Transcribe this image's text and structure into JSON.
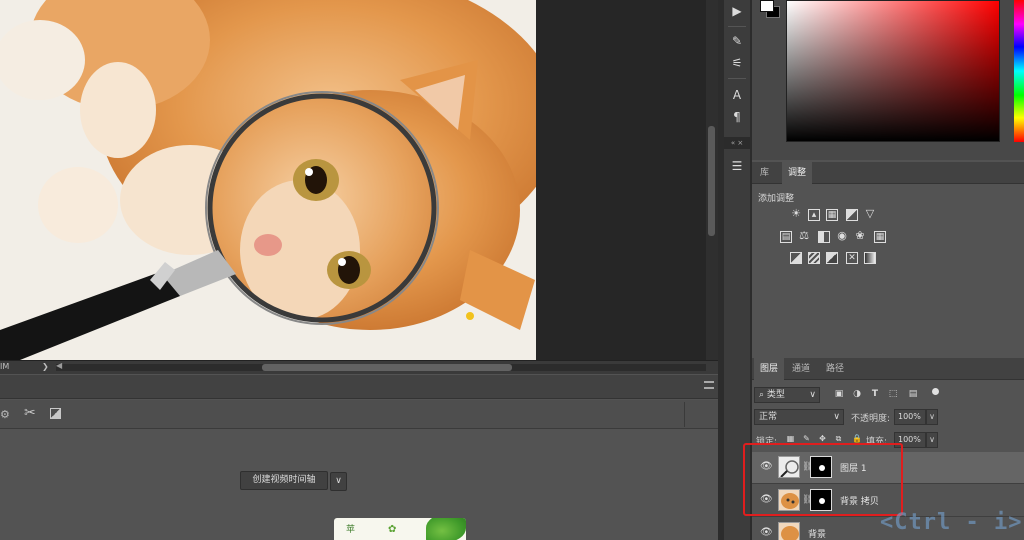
{
  "status_bar": {
    "zoom_text": "IM",
    "arrow": "❯",
    "scroll_left": "◀"
  },
  "timeline": {
    "create_button": "创建视频时间轴",
    "dropdown_arrow": "∨",
    "thumbnail_text": "苹"
  },
  "tool_strip": {
    "play": "▶",
    "brush_settings": "✎",
    "brush_presets": "⚟",
    "character": "A",
    "paragraph": "¶",
    "collapse": "« ×",
    "properties": "☰"
  },
  "color_panel": {
    "foreground": "#ffffff",
    "background": "#000000"
  },
  "adjustments": {
    "tabs": [
      {
        "label": "库",
        "active": false
      },
      {
        "label": "调整",
        "active": true
      }
    ],
    "add_label": "添加调整",
    "icons": [
      [
        "brightness-icon",
        "curves-icon",
        "levels-icon",
        "exposure-icon",
        "vibrance-icon"
      ],
      [
        "hue-sat-icon",
        "color-balance-icon",
        "black-white-icon",
        "photo-filter-icon",
        "channel-mixer-icon",
        "color-lookup-icon"
      ],
      [
        "invert-icon",
        "posterize-icon",
        "threshold-icon",
        "selective-color-icon",
        "gradient-map-icon"
      ]
    ]
  },
  "layers": {
    "tabs": [
      {
        "label": "图层",
        "active": true
      },
      {
        "label": "通道",
        "active": false
      },
      {
        "label": "路径",
        "active": false
      }
    ],
    "filter_kind": "类型",
    "blend_mode": "正常",
    "opacity_label": "不透明度:",
    "opacity_value": "100%",
    "lock_label": "锁定:",
    "fill_label": "填充:",
    "fill_value": "100%",
    "items": [
      {
        "name": "图层 1",
        "selected": true
      },
      {
        "name": "背景 拷贝",
        "selected": false
      },
      {
        "name": "背景",
        "selected": false
      }
    ]
  },
  "watermark": "<Ctrl - i>",
  "colors": {
    "highlight": "#e01e1e",
    "panel_bg": "#535353"
  }
}
